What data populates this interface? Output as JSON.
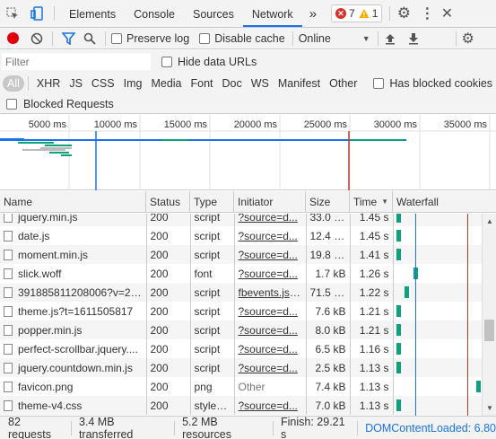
{
  "devtools": {
    "tabs": [
      "Elements",
      "Console",
      "Sources",
      "Network"
    ],
    "active_tab": "Network",
    "more_tabs": "»",
    "error_count": "7",
    "warning_count": "1"
  },
  "toolbar": {
    "preserve_log": "Preserve log",
    "disable_cache": "Disable cache",
    "throttle": "Online"
  },
  "filter": {
    "placeholder": "Filter",
    "hide_data_urls": "Hide data URLs",
    "types": [
      "All",
      "XHR",
      "JS",
      "CSS",
      "Img",
      "Media",
      "Font",
      "Doc",
      "WS",
      "Manifest",
      "Other"
    ],
    "selected_type": "All",
    "has_blocked_cookies": "Has blocked cookies",
    "blocked_requests": "Blocked Requests"
  },
  "overview": {
    "ticks": [
      "5000 ms",
      "10000 ms",
      "15000 ms",
      "20000 ms",
      "25000 ms",
      "30000 ms",
      "35000 ms"
    ]
  },
  "table": {
    "headers": {
      "name": "Name",
      "status": "Status",
      "type": "Type",
      "initiator": "Initiator",
      "size": "Size",
      "time": "Time",
      "waterfall": "Waterfall"
    },
    "rows": [
      {
        "name": "jquery.min.js",
        "status": "200",
        "type": "script",
        "initiator": "?source=d...",
        "size": "33.0 kB",
        "time": "1.45 s",
        "wf": 0.03
      },
      {
        "name": "date.js",
        "status": "200",
        "type": "script",
        "initiator": "?source=d...",
        "size": "12.4 kB",
        "time": "1.45 s",
        "wf": 0.03
      },
      {
        "name": "moment.min.js",
        "status": "200",
        "type": "script",
        "initiator": "?source=d...",
        "size": "19.8 kB",
        "time": "1.41 s",
        "wf": 0.03
      },
      {
        "name": "slick.woff",
        "status": "200",
        "type": "font",
        "initiator": "?source=d...",
        "size": "1.7 kB",
        "time": "1.26 s",
        "wf": 0.22
      },
      {
        "name": "391885811208006?v=2....",
        "status": "200",
        "type": "script",
        "initiator": "fbevents.js:23",
        "size": "71.5 kB",
        "time": "1.22 s",
        "wf": 0.12
      },
      {
        "name": "theme.js?t=1611505817",
        "status": "200",
        "type": "script",
        "initiator": "?source=d...",
        "size": "7.6 kB",
        "time": "1.21 s",
        "wf": 0.03
      },
      {
        "name": "popper.min.js",
        "status": "200",
        "type": "script",
        "initiator": "?source=d...",
        "size": "8.0 kB",
        "time": "1.21 s",
        "wf": 0.03
      },
      {
        "name": "perfect-scrollbar.jquery....",
        "status": "200",
        "type": "script",
        "initiator": "?source=d...",
        "size": "6.5 kB",
        "time": "1.16 s",
        "wf": 0.03
      },
      {
        "name": "jquery.countdown.min.js",
        "status": "200",
        "type": "script",
        "initiator": "?source=d...",
        "size": "2.5 kB",
        "time": "1.13 s",
        "wf": 0.03
      },
      {
        "name": "favicon.png",
        "status": "200",
        "type": "png",
        "initiator": "Other",
        "size": "7.4 kB",
        "time": "1.13 s",
        "wf": 0.93
      },
      {
        "name": "theme-v4.css",
        "status": "200",
        "type": "styles...",
        "initiator": "?source=d...",
        "size": "7.0 kB",
        "time": "1.13 s",
        "wf": 0.03
      }
    ]
  },
  "status_bar": {
    "requests": "82 requests",
    "transferred": "3.4 MB transferred",
    "resources": "5.2 MB resources",
    "finish": "Finish: 29.21 s",
    "dom_loaded": "DOMContentLoaded: 6.80"
  },
  "colors": {
    "accent": "#1a73e8",
    "waterfall_bar": "#0fa07d",
    "dom_line": "#1a73e8",
    "load_line": "#c0392b",
    "error": "#d93025",
    "warning": "#f9ab00"
  }
}
